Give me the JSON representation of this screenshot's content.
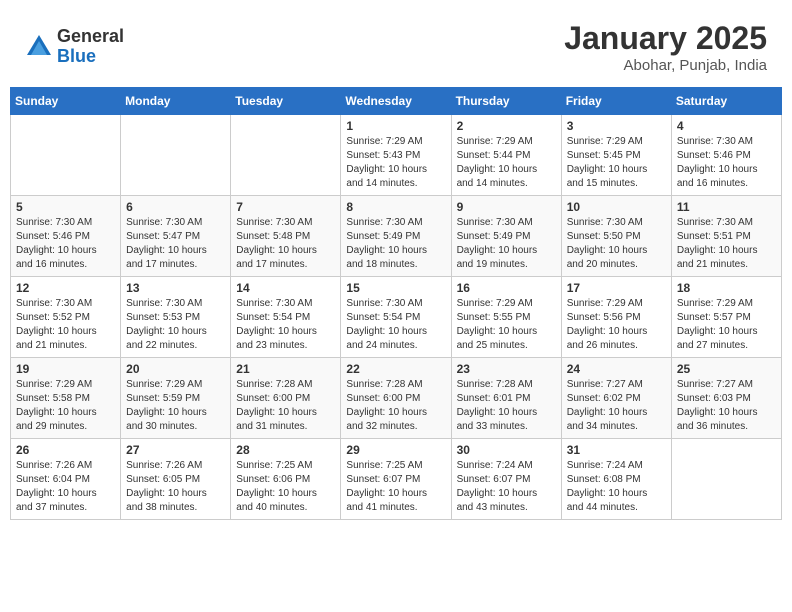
{
  "logo": {
    "general": "General",
    "blue": "Blue"
  },
  "header": {
    "month": "January 2025",
    "location": "Abohar, Punjab, India"
  },
  "days_of_week": [
    "Sunday",
    "Monday",
    "Tuesday",
    "Wednesday",
    "Thursday",
    "Friday",
    "Saturday"
  ],
  "weeks": [
    [
      {
        "day": "",
        "info": ""
      },
      {
        "day": "",
        "info": ""
      },
      {
        "day": "",
        "info": ""
      },
      {
        "day": "1",
        "info": "Sunrise: 7:29 AM\nSunset: 5:43 PM\nDaylight: 10 hours\nand 14 minutes."
      },
      {
        "day": "2",
        "info": "Sunrise: 7:29 AM\nSunset: 5:44 PM\nDaylight: 10 hours\nand 14 minutes."
      },
      {
        "day": "3",
        "info": "Sunrise: 7:29 AM\nSunset: 5:45 PM\nDaylight: 10 hours\nand 15 minutes."
      },
      {
        "day": "4",
        "info": "Sunrise: 7:30 AM\nSunset: 5:46 PM\nDaylight: 10 hours\nand 16 minutes."
      }
    ],
    [
      {
        "day": "5",
        "info": "Sunrise: 7:30 AM\nSunset: 5:46 PM\nDaylight: 10 hours\nand 16 minutes."
      },
      {
        "day": "6",
        "info": "Sunrise: 7:30 AM\nSunset: 5:47 PM\nDaylight: 10 hours\nand 17 minutes."
      },
      {
        "day": "7",
        "info": "Sunrise: 7:30 AM\nSunset: 5:48 PM\nDaylight: 10 hours\nand 17 minutes."
      },
      {
        "day": "8",
        "info": "Sunrise: 7:30 AM\nSunset: 5:49 PM\nDaylight: 10 hours\nand 18 minutes."
      },
      {
        "day": "9",
        "info": "Sunrise: 7:30 AM\nSunset: 5:49 PM\nDaylight: 10 hours\nand 19 minutes."
      },
      {
        "day": "10",
        "info": "Sunrise: 7:30 AM\nSunset: 5:50 PM\nDaylight: 10 hours\nand 20 minutes."
      },
      {
        "day": "11",
        "info": "Sunrise: 7:30 AM\nSunset: 5:51 PM\nDaylight: 10 hours\nand 21 minutes."
      }
    ],
    [
      {
        "day": "12",
        "info": "Sunrise: 7:30 AM\nSunset: 5:52 PM\nDaylight: 10 hours\nand 21 minutes."
      },
      {
        "day": "13",
        "info": "Sunrise: 7:30 AM\nSunset: 5:53 PM\nDaylight: 10 hours\nand 22 minutes."
      },
      {
        "day": "14",
        "info": "Sunrise: 7:30 AM\nSunset: 5:54 PM\nDaylight: 10 hours\nand 23 minutes."
      },
      {
        "day": "15",
        "info": "Sunrise: 7:30 AM\nSunset: 5:54 PM\nDaylight: 10 hours\nand 24 minutes."
      },
      {
        "day": "16",
        "info": "Sunrise: 7:29 AM\nSunset: 5:55 PM\nDaylight: 10 hours\nand 25 minutes."
      },
      {
        "day": "17",
        "info": "Sunrise: 7:29 AM\nSunset: 5:56 PM\nDaylight: 10 hours\nand 26 minutes."
      },
      {
        "day": "18",
        "info": "Sunrise: 7:29 AM\nSunset: 5:57 PM\nDaylight: 10 hours\nand 27 minutes."
      }
    ],
    [
      {
        "day": "19",
        "info": "Sunrise: 7:29 AM\nSunset: 5:58 PM\nDaylight: 10 hours\nand 29 minutes."
      },
      {
        "day": "20",
        "info": "Sunrise: 7:29 AM\nSunset: 5:59 PM\nDaylight: 10 hours\nand 30 minutes."
      },
      {
        "day": "21",
        "info": "Sunrise: 7:28 AM\nSunset: 6:00 PM\nDaylight: 10 hours\nand 31 minutes."
      },
      {
        "day": "22",
        "info": "Sunrise: 7:28 AM\nSunset: 6:00 PM\nDaylight: 10 hours\nand 32 minutes."
      },
      {
        "day": "23",
        "info": "Sunrise: 7:28 AM\nSunset: 6:01 PM\nDaylight: 10 hours\nand 33 minutes."
      },
      {
        "day": "24",
        "info": "Sunrise: 7:27 AM\nSunset: 6:02 PM\nDaylight: 10 hours\nand 34 minutes."
      },
      {
        "day": "25",
        "info": "Sunrise: 7:27 AM\nSunset: 6:03 PM\nDaylight: 10 hours\nand 36 minutes."
      }
    ],
    [
      {
        "day": "26",
        "info": "Sunrise: 7:26 AM\nSunset: 6:04 PM\nDaylight: 10 hours\nand 37 minutes."
      },
      {
        "day": "27",
        "info": "Sunrise: 7:26 AM\nSunset: 6:05 PM\nDaylight: 10 hours\nand 38 minutes."
      },
      {
        "day": "28",
        "info": "Sunrise: 7:25 AM\nSunset: 6:06 PM\nDaylight: 10 hours\nand 40 minutes."
      },
      {
        "day": "29",
        "info": "Sunrise: 7:25 AM\nSunset: 6:07 PM\nDaylight: 10 hours\nand 41 minutes."
      },
      {
        "day": "30",
        "info": "Sunrise: 7:24 AM\nSunset: 6:07 PM\nDaylight: 10 hours\nand 43 minutes."
      },
      {
        "day": "31",
        "info": "Sunrise: 7:24 AM\nSunset: 6:08 PM\nDaylight: 10 hours\nand 44 minutes."
      },
      {
        "day": "",
        "info": ""
      }
    ]
  ]
}
